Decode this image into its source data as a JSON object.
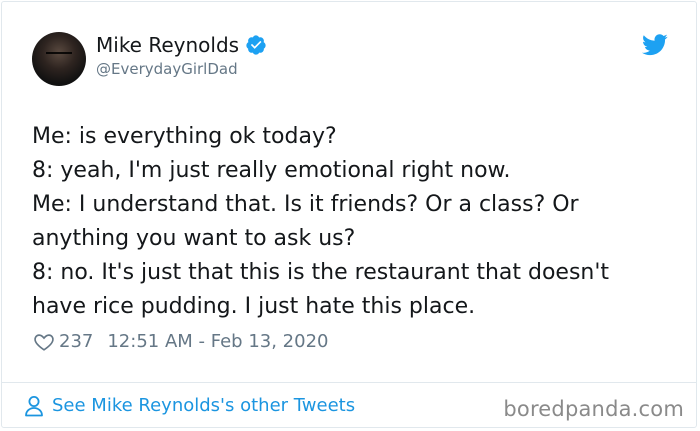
{
  "author": {
    "display_name": "Mike Reynolds",
    "handle": "@EverydayGirlDad",
    "verified": true
  },
  "tweet": {
    "lines": [
      "Me: is everything ok today?",
      "8: yeah, I'm just really emotional right now.",
      "Me: I understand that. Is it friends? Or a class? Or",
      "anything you want to ask us?",
      "8: no. It's just that this is the restaurant that doesn't",
      "have rice pudding. I just hate this place."
    ]
  },
  "meta": {
    "likes": "237",
    "timestamp": "12:51 AM - Feb 13, 2020"
  },
  "footer": {
    "link_label": "See Mike Reynolds's other Tweets"
  },
  "watermark": "boredpanda.com",
  "icons": {
    "verified": "verified-badge-icon",
    "brand": "twitter-bird-icon",
    "like": "heart-outline-icon",
    "profile": "person-icon"
  },
  "colors": {
    "twitter_blue": "#1da1f2",
    "link_blue": "#1b95e0",
    "secondary_text": "#657786",
    "border": "#e1e8ed"
  }
}
